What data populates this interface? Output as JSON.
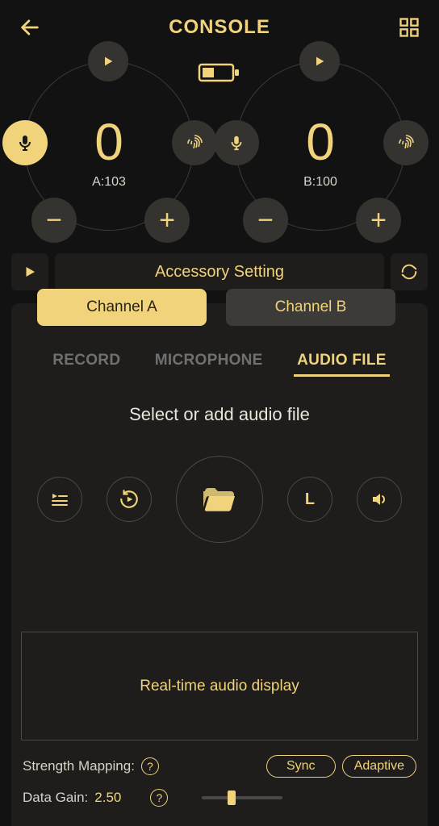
{
  "header": {
    "title": "CONSOLE"
  },
  "channelA": {
    "value": "0",
    "label": "A:103"
  },
  "channelB": {
    "value": "0",
    "label": "B:100"
  },
  "accessory": {
    "label": "Accessory Setting"
  },
  "channelTabs": {
    "a": "Channel A",
    "b": "Channel B"
  },
  "modeTabs": {
    "record": "RECORD",
    "microphone": "MICROPHONE",
    "audiofile": "AUDIO FILE"
  },
  "prompt": "Select or add audio file",
  "actionL": "L",
  "realtimeBox": "Real-time audio display",
  "settings": {
    "strengthLabel": "Strength Mapping:",
    "syncLabel": "Sync",
    "adaptiveLabel": "Adaptive",
    "dataGainLabel": "Data Gain:",
    "dataGainValue": "2.50"
  }
}
